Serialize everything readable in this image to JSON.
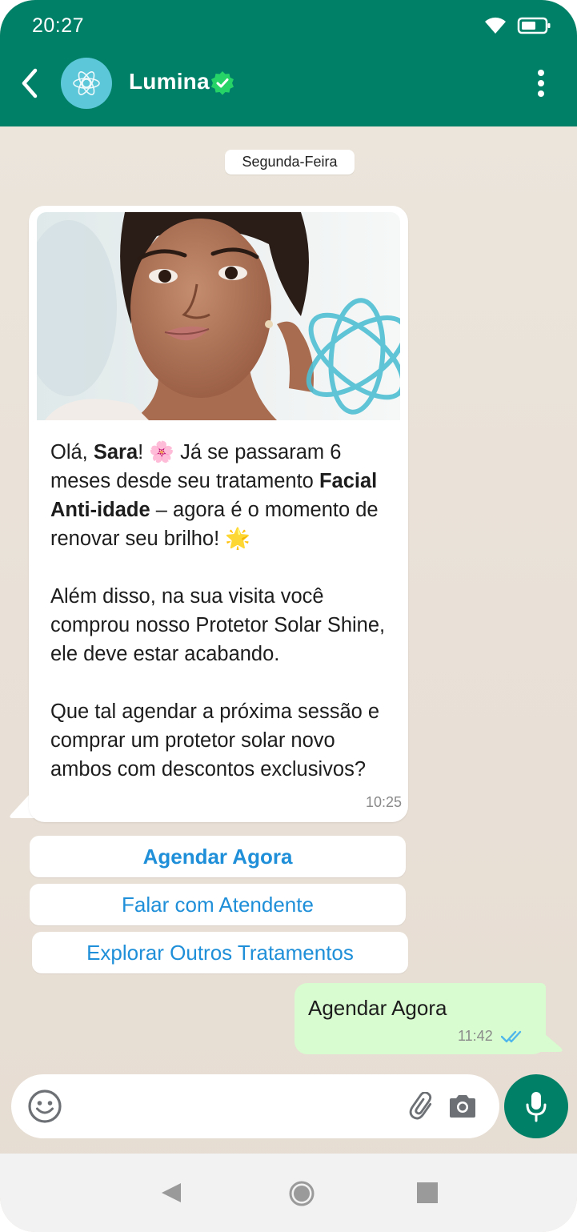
{
  "status_bar": {
    "time": "20:27"
  },
  "header": {
    "contact_name": "Lumina"
  },
  "chat": {
    "date_chip": "Segunda-Feira",
    "incoming": {
      "greeting_prefix": "Olá, ",
      "name": "Sara",
      "greeting_rest": "! 🌸 Já se passaram 6 meses desde seu tratamento ",
      "treatment": "Facial Anti-idade",
      "treatment_rest": " – agora é o momento de renovar seu brilho! 🌟",
      "paragraph2": "Além disso, na sua visita você comprou nosso Protetor Solar Shine, ele deve estar acabando.",
      "paragraph3": "Que tal agendar a próxima sessão e comprar um protetor solar novo ambos com descontos exclusivos?",
      "time": "10:25"
    },
    "quick_replies": [
      "Agendar Agora",
      "Falar com Atendente",
      "Explorar Outros Tratamentos"
    ],
    "outgoing": {
      "text": "Agendar Agora",
      "time": "11:42"
    }
  },
  "input": {
    "placeholder": ""
  },
  "colors": {
    "header": "#018068",
    "link": "#1e8fd8",
    "outgoing_bubble": "#d8fccf",
    "tick": "#4fb6ec"
  }
}
